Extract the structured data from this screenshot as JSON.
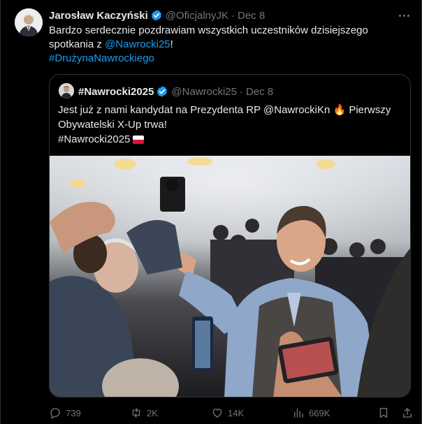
{
  "tweet": {
    "author_name": "Jarosław Kaczyński",
    "handle": "@OficjalnyJK",
    "separator": "·",
    "date": "Dec 8",
    "text_part1": "Bardzo serdecznie pozdrawiam wszystkich uczestników dzisiejszego spotkania z ",
    "mention": "@Nawrocki25",
    "text_part2": "!",
    "hashtag": "#DrużynaNawrockiego"
  },
  "quoted": {
    "author_name": "#Nawrocki2025",
    "handle": "@Nawrocki25",
    "separator": "·",
    "date": "Dec 8",
    "line1_a": "Jest już z nami kandydat na Prezydenta RP @NawrockiKn",
    "line1_emoji": "🔥",
    "line1_b": "Pierwszy",
    "line2": "Obywatelski X-Up trwa!",
    "line3": "#Nawrocki2025"
  },
  "actions": {
    "replies": "739",
    "reposts": "2K",
    "likes": "14K",
    "views": "669K"
  },
  "colors": {
    "background": "#000000",
    "text": "#e7e9ea",
    "muted": "#71767b",
    "link": "#1d9bf0",
    "border": "#2f3336",
    "verified": "#1d9bf0"
  }
}
